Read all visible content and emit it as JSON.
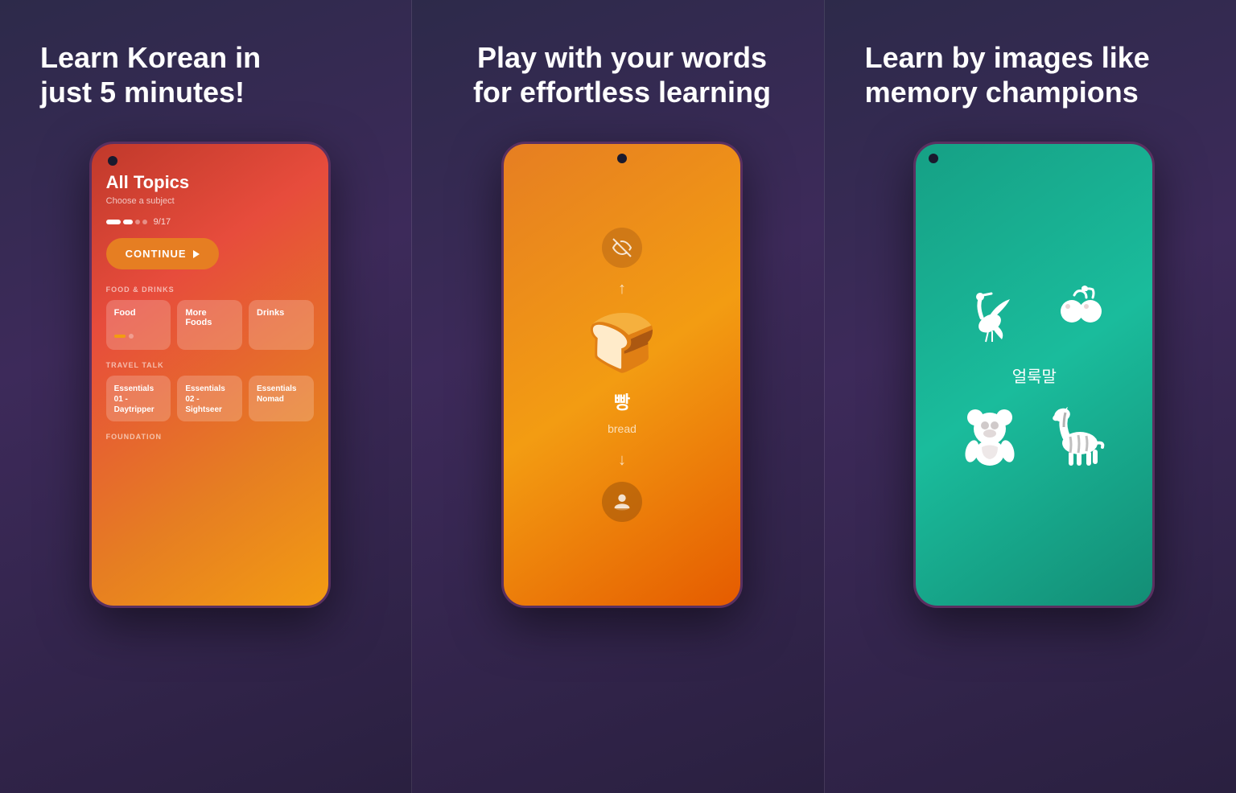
{
  "panel1": {
    "title": "Learn Korean in just 5 minutes!",
    "phone": {
      "allTopics": "All Topics",
      "chooseSubject": "Choose a subject",
      "progressText": "9/17",
      "continueLabel": "CONTINUE",
      "foodDrinksLabel": "FOOD & DRINKS",
      "travelTalkLabel": "TRAVEL TALK",
      "foundationLabel": "FOUNDATION",
      "cards": [
        {
          "title": "Food"
        },
        {
          "title": "More Foods"
        },
        {
          "title": "Drinks"
        }
      ],
      "travelCards": [
        {
          "title": "Essentials 01 - Daytripper"
        },
        {
          "title": "Essentials 02 - Sightseer"
        },
        {
          "title": "Essentials Nomad"
        }
      ]
    }
  },
  "panel2": {
    "title": "Play with your words for effortless learning",
    "phone": {
      "koreanWord": "빵",
      "englishWord": "bread"
    }
  },
  "panel3": {
    "title": "Learn by images like memory champions",
    "phone": {
      "koreanWord": "얼룩말"
    }
  }
}
